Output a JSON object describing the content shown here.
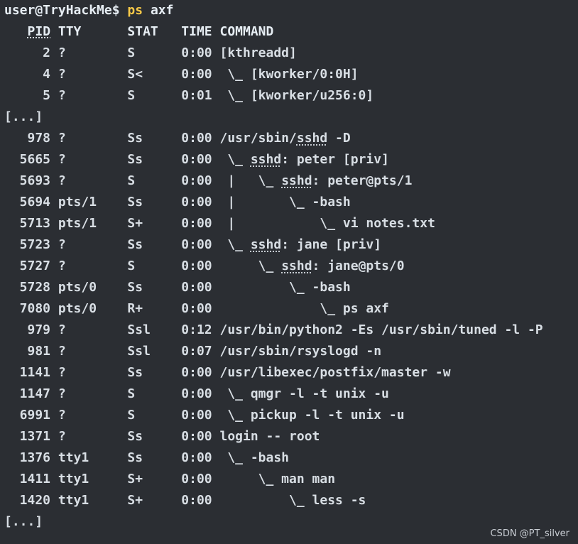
{
  "prompt": {
    "user_host": "user@TryHackMe",
    "sign": "$",
    "command": "ps",
    "args": "axf"
  },
  "header": {
    "pid": "PID",
    "tty": "TTY",
    "stat": "STAT",
    "time": "TIME",
    "command": "COMMAND"
  },
  "rows": [
    {
      "pid": "2",
      "tty": "?",
      "stat": "S",
      "time": "0:00",
      "cmd_prefix": "",
      "cmd_under": "",
      "cmd_rest": "[kthreadd]"
    },
    {
      "pid": "4",
      "tty": "?",
      "stat": "S<",
      "time": "0:00",
      "cmd_prefix": " \\_ ",
      "cmd_under": "",
      "cmd_rest": "[kworker/0:0H]"
    },
    {
      "pid": "5",
      "tty": "?",
      "stat": "S",
      "time": "0:01",
      "cmd_prefix": " \\_ ",
      "cmd_under": "",
      "cmd_rest": "[kworker/u256:0]"
    }
  ],
  "ellipsis_1": "[...]",
  "rows2": [
    {
      "pid": "978",
      "tty": "?",
      "stat": "Ss",
      "time": "0:00",
      "cmd_prefix": "/usr/sbin/",
      "cmd_under": "sshd",
      "cmd_rest": " -D"
    },
    {
      "pid": "5665",
      "tty": "?",
      "stat": "Ss",
      "time": "0:00",
      "cmd_prefix": " \\_ ",
      "cmd_under": "sshd",
      "cmd_rest": ": peter [priv]"
    },
    {
      "pid": "5693",
      "tty": "?",
      "stat": "S",
      "time": "0:00",
      "cmd_prefix": " |   \\_ ",
      "cmd_under": "sshd",
      "cmd_rest": ": peter@pts/1"
    },
    {
      "pid": "5694",
      "tty": "pts/1",
      "stat": "Ss",
      "time": "0:00",
      "cmd_prefix": " |       \\_ -bash",
      "cmd_under": "",
      "cmd_rest": ""
    },
    {
      "pid": "5713",
      "tty": "pts/1",
      "stat": "S+",
      "time": "0:00",
      "cmd_prefix": " |           \\_ vi notes.txt",
      "cmd_under": "",
      "cmd_rest": ""
    },
    {
      "pid": "5723",
      "tty": "?",
      "stat": "Ss",
      "time": "0:00",
      "cmd_prefix": " \\_ ",
      "cmd_under": "sshd",
      "cmd_rest": ": jane [priv]"
    },
    {
      "pid": "5727",
      "tty": "?",
      "stat": "S",
      "time": "0:00",
      "cmd_prefix": "     \\_ ",
      "cmd_under": "sshd",
      "cmd_rest": ": jane@pts/0"
    },
    {
      "pid": "5728",
      "tty": "pts/0",
      "stat": "Ss",
      "time": "0:00",
      "cmd_prefix": "         \\_ -bash",
      "cmd_under": "",
      "cmd_rest": ""
    },
    {
      "pid": "7080",
      "tty": "pts/0",
      "stat": "R+",
      "time": "0:00",
      "cmd_prefix": "             \\_ ps axf",
      "cmd_under": "",
      "cmd_rest": ""
    },
    {
      "pid": "979",
      "tty": "?",
      "stat": "Ssl",
      "time": "0:12",
      "cmd_prefix": "/usr/bin/python2 -Es /usr/sbin/tuned -l -P",
      "cmd_under": "",
      "cmd_rest": ""
    },
    {
      "pid": "981",
      "tty": "?",
      "stat": "Ssl",
      "time": "0:07",
      "cmd_prefix": "/usr/sbin/rsyslogd -n",
      "cmd_under": "",
      "cmd_rest": ""
    },
    {
      "pid": "1141",
      "tty": "?",
      "stat": "Ss",
      "time": "0:00",
      "cmd_prefix": "/usr/libexec/postfix/master -w",
      "cmd_under": "",
      "cmd_rest": ""
    },
    {
      "pid": "1147",
      "tty": "?",
      "stat": "S",
      "time": "0:00",
      "cmd_prefix": " \\_ qmgr -l -t unix -u",
      "cmd_under": "",
      "cmd_rest": ""
    },
    {
      "pid": "6991",
      "tty": "?",
      "stat": "S",
      "time": "0:00",
      "cmd_prefix": " \\_ pickup -l -t unix -u",
      "cmd_under": "",
      "cmd_rest": ""
    },
    {
      "pid": "1371",
      "tty": "?",
      "stat": "Ss",
      "time": "0:00",
      "cmd_prefix": "login -- root",
      "cmd_under": "",
      "cmd_rest": ""
    },
    {
      "pid": "1376",
      "tty": "tty1",
      "stat": "Ss",
      "time": "0:00",
      "cmd_prefix": " \\_ -bash",
      "cmd_under": "",
      "cmd_rest": ""
    },
    {
      "pid": "1411",
      "tty": "tty1",
      "stat": "S+",
      "time": "0:00",
      "cmd_prefix": "     \\_ man man",
      "cmd_under": "",
      "cmd_rest": ""
    },
    {
      "pid": "1420",
      "tty": "tty1",
      "stat": "S+",
      "time": "0:00",
      "cmd_prefix": "         \\_ less -s",
      "cmd_under": "",
      "cmd_rest": ""
    }
  ],
  "ellipsis_2": "[...]",
  "watermark": "CSDN @PT_silver"
}
